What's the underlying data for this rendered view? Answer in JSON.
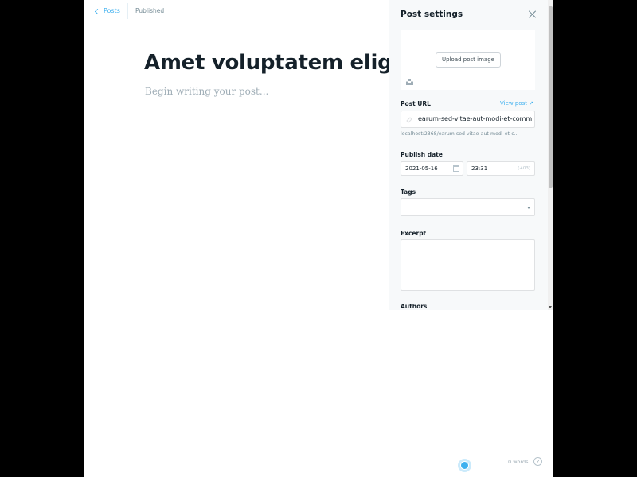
{
  "editor": {
    "back_label": "Posts",
    "status": "Published",
    "title": "Amet voluptatem elige",
    "body_placeholder": "Begin writing your post..."
  },
  "footer": {
    "word_count": "0 words",
    "help_label": "?"
  },
  "settings": {
    "title": "Post settings",
    "upload_label": "Upload post image",
    "post_url": {
      "label": "Post URL",
      "view_post": "View post",
      "value": "earum-sed-vitae-aut-modi-et-comm",
      "hint": "localhost:2368/earum-sed-vitae-aut-modi-et-c..."
    },
    "publish_date": {
      "label": "Publish date",
      "date": "2021-05-16",
      "time": "23:31",
      "timezone": "(+03)"
    },
    "tags": {
      "label": "Tags",
      "value": ""
    },
    "excerpt": {
      "label": "Excerpt",
      "value": ""
    },
    "authors": {
      "label": "Authors"
    }
  },
  "colors": {
    "accent": "#3eb0ef",
    "title_text": "#15212a",
    "muted_text": "#738a94",
    "panel_bg": "#f7f9fa"
  }
}
